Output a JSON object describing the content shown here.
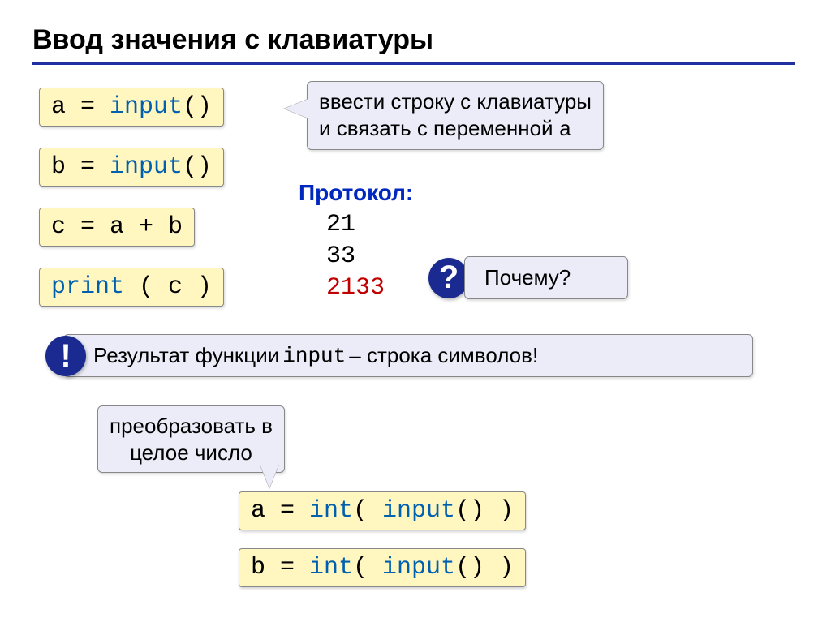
{
  "title": "Ввод значения с клавиатуры",
  "code_boxes": {
    "a_input_pre": "a = ",
    "a_input_kw": "input",
    "a_input_post": "()",
    "b_input_pre": "b = ",
    "b_input_kw": "input",
    "b_input_post": "()",
    "c_assign": "c = a + b",
    "print_kw": "print",
    "print_arg": " ( c )",
    "a_int_pre": "a = ",
    "a_int_kw1": "int",
    "a_int_mid": "( ",
    "a_int_kw2": "input",
    "a_int_post": "() )",
    "b_int_pre": "b = ",
    "b_int_kw1": "int",
    "b_int_mid": "( ",
    "b_int_kw2": "input",
    "b_int_post": "() )"
  },
  "callouts": {
    "input_explain_l1": "ввести строку с клавиатуры",
    "input_explain_l2_pre": "и связать с переменной ",
    "input_explain_l2_var": "a",
    "why": "Почему?",
    "result_pre": "Результат функции ",
    "result_fn": "input",
    "result_post": " – строка символов!",
    "convert_l1": "преобразовать в",
    "convert_l2": "целое число"
  },
  "protocol": {
    "label": "Протокол:",
    "v1": "21",
    "v2": "33",
    "v3": "2133"
  },
  "icons": {
    "question": "?",
    "exclaim": "!"
  }
}
